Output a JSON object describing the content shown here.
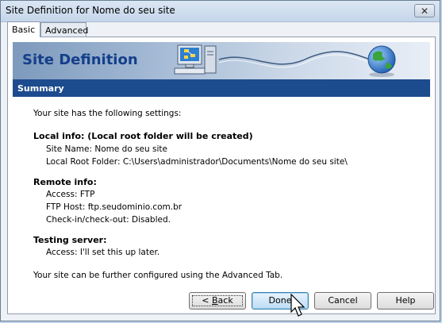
{
  "window": {
    "title": "Site Definition for Nome do seu site",
    "close_glyph": "✕"
  },
  "tabs": [
    {
      "label": "Basic",
      "active": true
    },
    {
      "label": "Advanced",
      "active": false
    }
  ],
  "banner": {
    "title": "Site Definition",
    "icons": [
      "computer-icon",
      "globe-icon"
    ]
  },
  "summary": {
    "header": "Summary",
    "intro": "Your site has the following settings:",
    "local_heading": "Local info: (Local root folder will be created)",
    "site_name": "Site Name: Nome do seu site",
    "local_root": "Local Root Folder: C:\\Users\\administrador\\Documents\\Nome do seu site\\",
    "remote_heading": "Remote info:",
    "access": "Access: FTP",
    "ftp_host": "FTP Host: ftp.seudominio.com.br",
    "checkin": "Check-in/check-out: Disabled.",
    "testing_heading": "Testing server:",
    "testing_access": "Access: I'll set this up later.",
    "footer": "Your site can be further configured using the Advanced Tab."
  },
  "buttons": {
    "back_prefix": "< ",
    "back_accel": "B",
    "back_rest": "ack",
    "done": "Done",
    "cancel": "Cancel",
    "help": "Help"
  },
  "colors": {
    "summary_bar": "#1c4b8e",
    "banner_title": "#143f8a"
  }
}
